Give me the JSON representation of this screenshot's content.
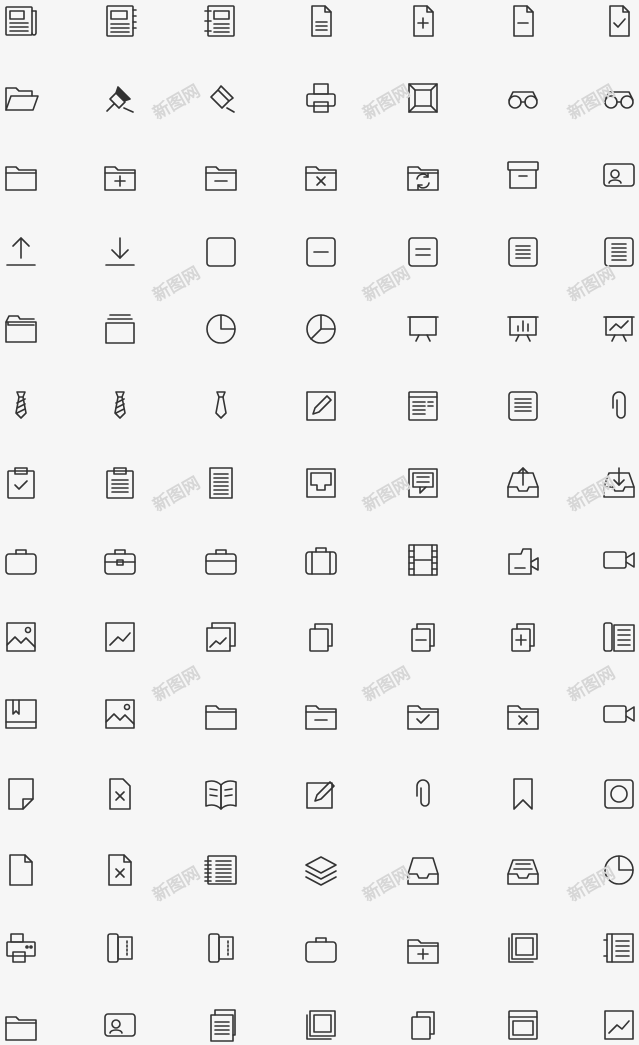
{
  "watermark": "新图网",
  "colors": {
    "background": "#f6f6f6",
    "icon_stroke": "#333333",
    "watermark": "#d6d6d6"
  },
  "icons": [
    [
      "newspaper-icon",
      "newspaper-binder-icon",
      "notebook-icon",
      "document-lines-icon",
      "document-add-icon",
      "document-remove-icon",
      "document-check-icon"
    ],
    [
      "folder-open-icon",
      "pin-filled-icon",
      "pin-icon",
      "printer-icon",
      "box-frame-icon",
      "glasses-icon",
      "glasses-icon"
    ],
    [
      "folder-icon",
      "folder-add-icon",
      "folder-remove-icon",
      "folder-delete-icon",
      "folder-sync-icon",
      "archive-box-icon",
      "id-card-icon"
    ],
    [
      "upload-icon",
      "download-icon",
      "square-icon",
      "square-minus-icon",
      "square-equal-icon",
      "square-lines-icon",
      "square-lines-many-icon"
    ],
    [
      "folder-empty-icon",
      "stack-icon",
      "pie-chart-icon",
      "pie-chart-slice-icon",
      "presentation-board-icon",
      "presentation-bar-chart-icon",
      "presentation-line-chart-icon"
    ],
    [
      "tie-striped-icon",
      "tie-striped-icon",
      "tie-icon",
      "edit-pencil-icon",
      "window-text-icon",
      "list-icon",
      "paperclip-icon"
    ],
    [
      "clipboard-check-icon",
      "clipboard-icon",
      "document-text-icon",
      "frame-tray-icon",
      "frame-message-icon",
      "inbox-upload-icon",
      "inbox-download-icon"
    ],
    [
      "briefcase-icon",
      "briefcase-lock-icon",
      "briefcase-strap-icon",
      "suitcase-icon",
      "film-strip-icon",
      "video-folder-icon",
      "video-camera-icon"
    ],
    [
      "image-icon",
      "image-chart-icon",
      "images-icon",
      "copy-icon",
      "copy-remove-icon",
      "copy-add-icon",
      "book-pages-icon"
    ],
    [
      "book-icon",
      "photo-icon",
      "folder-icon",
      "folder-remove-icon",
      "folder-check-icon",
      "folder-delete-icon",
      "video-camera-icon"
    ],
    [
      "note-icon",
      "document-delete-icon",
      "book-open-icon",
      "edit-note-icon",
      "paperclip-icon",
      "bookmark-icon",
      "record-icon"
    ],
    [
      "document-icon",
      "file-delete-icon",
      "book-spiral-icon",
      "layers-icon",
      "inbox-tray-icon",
      "inbox-archive-icon",
      "pie-chart-icon"
    ],
    [
      "fax-icon",
      "ticket-icon",
      "ticket-icon",
      "briefcase-icon",
      "folder-add-icon",
      "photo-frame-icon",
      "notebook-lines-icon"
    ],
    [
      "folder-icon",
      "id-card-icon",
      "documents-icon",
      "photo-frame-icon",
      "copy-icon",
      "window-icon",
      "image-chart-icon"
    ]
  ]
}
